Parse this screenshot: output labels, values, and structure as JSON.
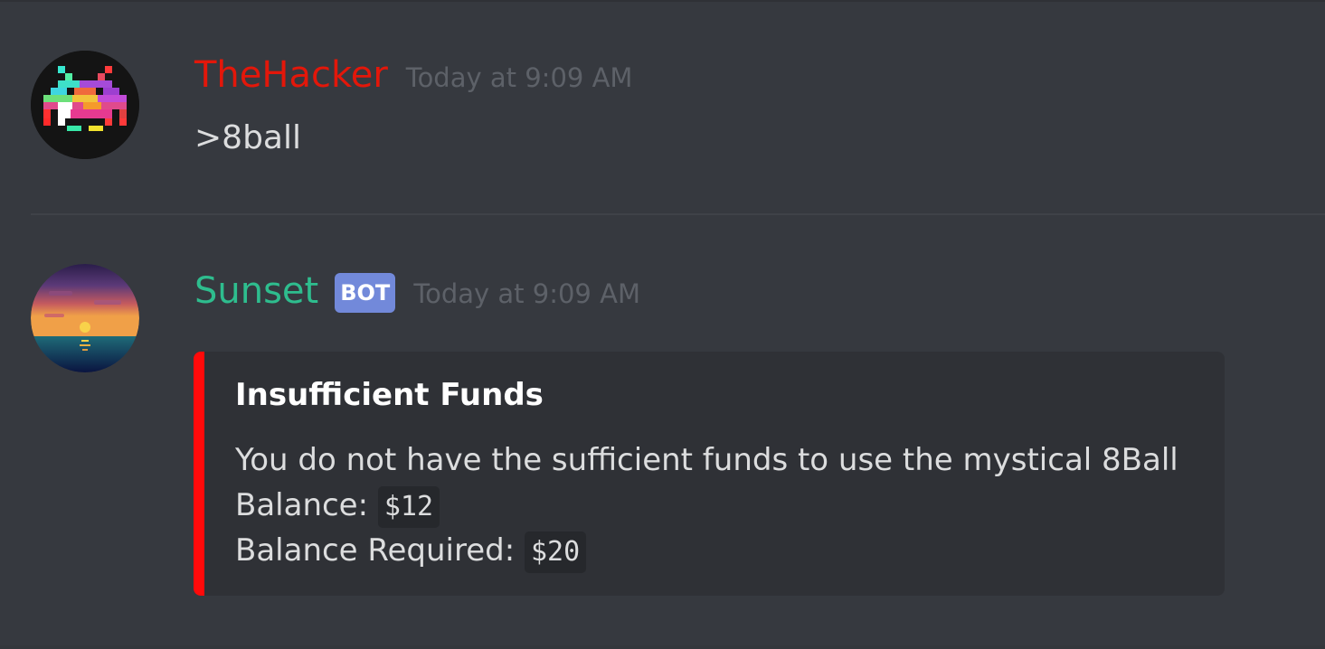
{
  "messages": [
    {
      "username": "TheHacker",
      "username_color": "#e3170a",
      "timestamp": "Today at 9:09 AM",
      "content": ">8ball",
      "avatar_icon": "space-invader-icon"
    },
    {
      "username": "Sunset",
      "username_color": "#2ebd8e",
      "badge": "BOT",
      "timestamp": "Today at 9:09 AM",
      "avatar_icon": "sunset-avatar-icon",
      "embed": {
        "accent_color": "#ff0a0a",
        "title": "Insufficient Funds",
        "line1": "You do not have the sufficient funds to use the mystical 8Ball",
        "balance_label": "Balance:",
        "balance_value": "$12",
        "required_label": "Balance Required:",
        "required_value": "$20"
      }
    }
  ]
}
